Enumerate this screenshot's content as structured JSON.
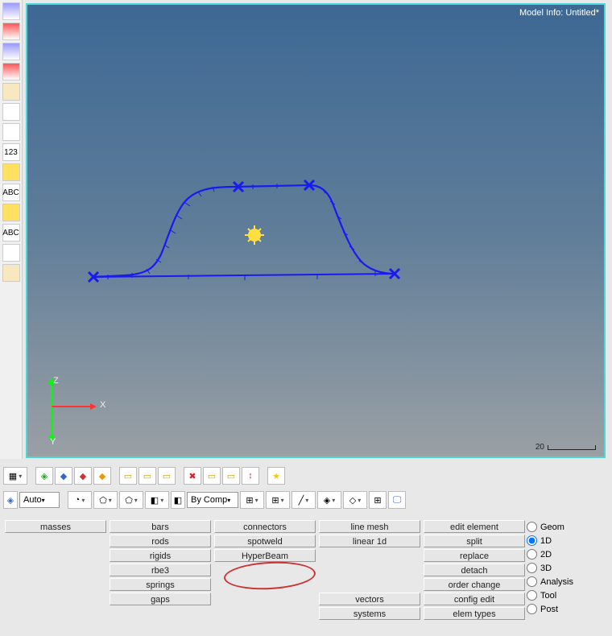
{
  "viewport": {
    "info_label": "Model Info: Untitled*",
    "scale_value": "20",
    "axis_x": "X",
    "axis_y": "Y",
    "axis_z": "Z"
  },
  "left_tools": [
    {
      "name": "sel-elems-icon",
      "cls": "blue"
    },
    {
      "name": "sel-nodes-icon",
      "cls": "red"
    },
    {
      "name": "sel-comps-icon",
      "cls": "blue"
    },
    {
      "name": "sel-props-icon",
      "cls": "red"
    },
    {
      "name": "sel-mats-icon",
      "cls": "tan"
    },
    {
      "name": "find-icon",
      "cls": ""
    },
    {
      "name": "info-icon",
      "cls": ""
    },
    {
      "name": "numbers-icon",
      "cls": "",
      "label": "123"
    },
    {
      "name": "dim-a-icon",
      "cls": "yellow"
    },
    {
      "name": "abc-a-icon",
      "cls": "",
      "label": "ABC"
    },
    {
      "name": "dim-b-icon",
      "cls": "yellow"
    },
    {
      "name": "abc-b-icon",
      "cls": "",
      "label": "ABC"
    },
    {
      "name": "measure-icon",
      "cls": ""
    },
    {
      "name": "box-icon",
      "cls": "tan"
    }
  ],
  "toolbar1": [
    {
      "name": "grid-icon",
      "dd": true,
      "glyph": "▦"
    },
    {
      "name": "sep"
    },
    {
      "name": "comp-green-icon",
      "glyph": "◈",
      "color": "#2a2"
    },
    {
      "name": "comp-blue-icon",
      "glyph": "◆",
      "color": "#36c"
    },
    {
      "name": "comp-red-icon",
      "glyph": "◆",
      "color": "#c33"
    },
    {
      "name": "comp-orange-icon",
      "glyph": "◆",
      "color": "#e90"
    },
    {
      "name": "sep"
    },
    {
      "name": "box-a-icon",
      "glyph": "▭",
      "color": "#c90"
    },
    {
      "name": "box-b-icon",
      "glyph": "▭",
      "color": "#c90"
    },
    {
      "name": "box-c-icon",
      "glyph": "▭",
      "color": "#c90"
    },
    {
      "name": "sep"
    },
    {
      "name": "delete-icon",
      "glyph": "✖",
      "color": "#d22"
    },
    {
      "name": "box-d-icon",
      "glyph": "▭",
      "color": "#c90"
    },
    {
      "name": "box-e-icon",
      "glyph": "▭",
      "color": "#c90"
    },
    {
      "name": "reorder-icon",
      "glyph": "↕",
      "color": "#c33"
    },
    {
      "name": "sep"
    },
    {
      "name": "favorite-icon",
      "glyph": "★",
      "color": "#f5c518"
    }
  ],
  "toolbar2": {
    "auto_label": "Auto",
    "bycomp_label": "By Comp",
    "items": [
      {
        "name": "shade-a-icon",
        "dd": true,
        "glyph": "◔"
      },
      {
        "name": "surf-icon",
        "dd": true,
        "glyph": "⬠"
      },
      {
        "name": "shade-b-icon",
        "dd": true,
        "glyph": "⬠"
      },
      {
        "name": "cube-a-icon",
        "dd": true,
        "glyph": "◧"
      },
      {
        "name": "bycomp",
        "type": "label"
      },
      {
        "name": "wire-a-icon",
        "dd": true,
        "glyph": "⊞"
      },
      {
        "name": "wire-b-icon",
        "dd": true,
        "glyph": "⊞"
      },
      {
        "name": "line-icon",
        "dd": true,
        "glyph": "╱"
      },
      {
        "name": "layer-icon",
        "dd": true,
        "glyph": "◈"
      },
      {
        "name": "diamond-icon",
        "dd": true,
        "glyph": "◇"
      },
      {
        "name": "grid2-icon",
        "glyph": "⊞"
      },
      {
        "name": "monitor-icon",
        "glyph": "🖵",
        "color": "#36c"
      }
    ]
  },
  "panel": {
    "rows": [
      [
        "masses",
        "bars",
        "connectors",
        "line mesh",
        "edit element"
      ],
      [
        "",
        "rods",
        "spotweld",
        "linear 1d",
        "split"
      ],
      [
        "",
        "rigids",
        "HyperBeam",
        "",
        "replace"
      ],
      [
        "",
        "rbe3",
        "",
        "",
        "detach"
      ],
      [
        "",
        "springs",
        "",
        "",
        "order change"
      ],
      [
        "",
        "gaps",
        "",
        "vectors",
        "config edit"
      ],
      [
        "",
        "",
        "",
        "systems",
        "elem types"
      ]
    ],
    "radios": [
      {
        "label": "Geom",
        "checked": false
      },
      {
        "label": "1D",
        "checked": true
      },
      {
        "label": "2D",
        "checked": false
      },
      {
        "label": "3D",
        "checked": false
      },
      {
        "label": "Analysis",
        "checked": false
      },
      {
        "label": "Tool",
        "checked": false
      },
      {
        "label": "Post",
        "checked": false
      }
    ]
  }
}
